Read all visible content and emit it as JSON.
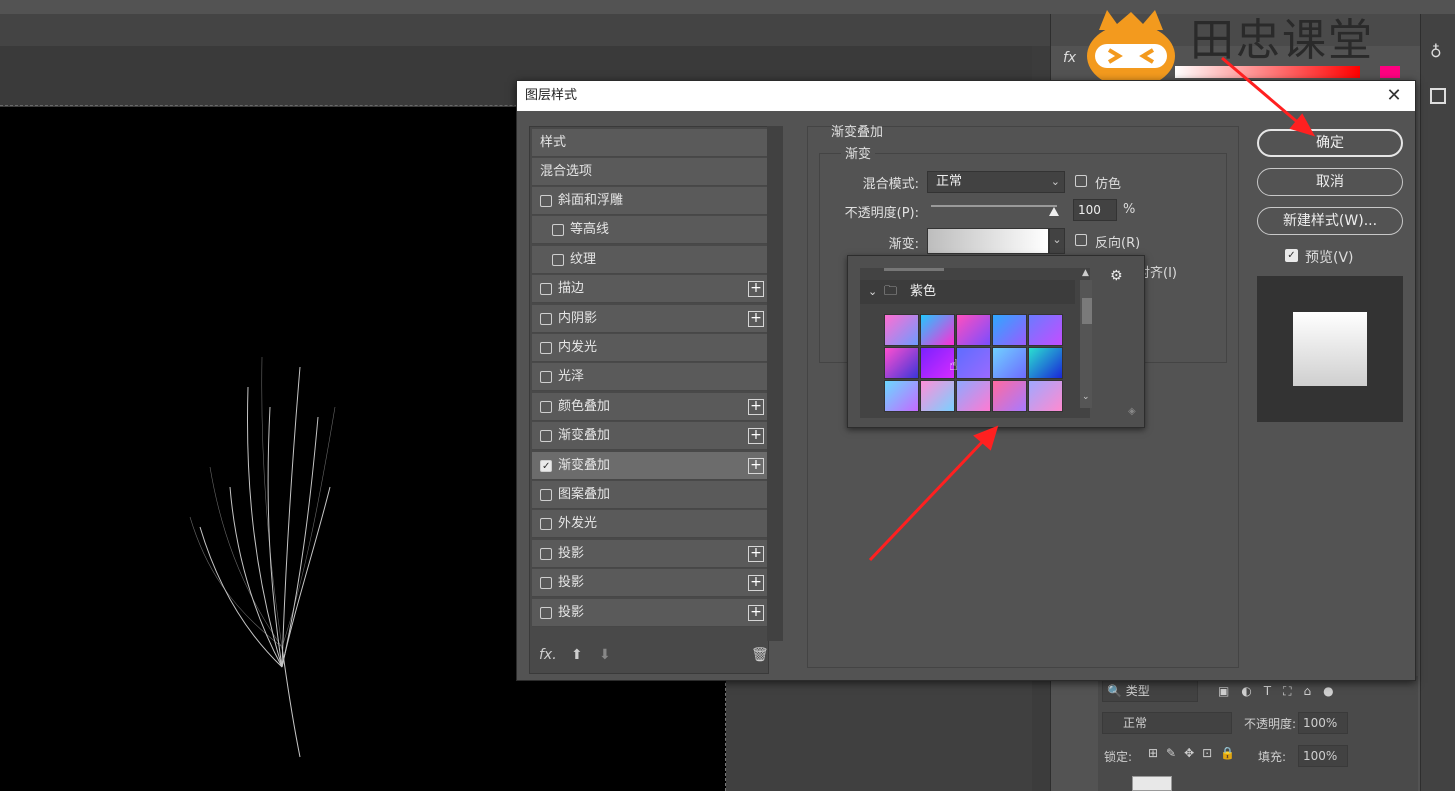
{
  "dialog": {
    "title": "图层样式",
    "close_label": "✕",
    "styles_header": "样式",
    "blend_options": "混合选项",
    "items": [
      {
        "label": "斜面和浮雕",
        "checked": false,
        "plus": false
      },
      {
        "label": "等高线",
        "checked": false,
        "plus": false
      },
      {
        "label": "纹理",
        "checked": false,
        "plus": false
      },
      {
        "label": "描边",
        "checked": false,
        "plus": true
      },
      {
        "label": "内阴影",
        "checked": false,
        "plus": true
      },
      {
        "label": "内发光",
        "checked": false,
        "plus": false
      },
      {
        "label": "光泽",
        "checked": false,
        "plus": false
      },
      {
        "label": "颜色叠加",
        "checked": false,
        "plus": true
      },
      {
        "label": "渐变叠加",
        "checked": false,
        "plus": true
      },
      {
        "label": "渐变叠加",
        "checked": true,
        "plus": true
      },
      {
        "label": "图案叠加",
        "checked": false,
        "plus": false
      },
      {
        "label": "外发光",
        "checked": false,
        "plus": false
      },
      {
        "label": "投影",
        "checked": false,
        "plus": true
      },
      {
        "label": "投影",
        "checked": false,
        "plus": true
      },
      {
        "label": "投影",
        "checked": false,
        "plus": true
      }
    ],
    "footer_fx": "fx.",
    "section_title": "渐变叠加",
    "sub_title": "渐变",
    "blend_mode_label": "混合模式:",
    "blend_mode_value": "正常",
    "dither_label": "仿色",
    "opacity_label": "不透明度(P):",
    "opacity_value": "100",
    "opacity_unit": "%",
    "opacity_level": 1.0,
    "gradient_label": "渐变:",
    "reverse_label": "反向(R)",
    "align_label_partial": "对齐(I)",
    "picker": {
      "folder_name": "紫色",
      "swatches": [
        [
          "#ff6ed2",
          "#6e9bff"
        ],
        [
          "#22c8ff",
          "#ff2dd6"
        ],
        [
          "#ff4fbf",
          "#7a4dff"
        ],
        [
          "#2ea8ff",
          "#9a5bff"
        ],
        [
          "#6b7bff",
          "#c44dff"
        ],
        [
          "#ff4fd0",
          "#3b35d8"
        ],
        [
          "#7a22ff",
          "#d62bff"
        ],
        [
          "#5f6dff",
          "#9a6aff"
        ],
        [
          "#6fd1ff",
          "#6e6bff"
        ],
        [
          "#2ae0d0",
          "#1a26d8"
        ],
        [
          "#6bd8ff",
          "#c46aff"
        ],
        [
          "#ff8fd8",
          "#7ad0ff"
        ],
        [
          "#8fa8ff",
          "#ff7ad2"
        ],
        [
          "#ff6aa0",
          "#a77aff"
        ],
        [
          "#a0a8ff",
          "#ff8ad0"
        ]
      ]
    },
    "buttons": {
      "ok": "确定",
      "cancel": "取消",
      "new_style": "新建样式(W)..."
    },
    "preview_label": "预览(V)",
    "preview_checked": true
  },
  "right_panel": {
    "fx_label": "fx",
    "layers_filter": "类型",
    "layers_blend": "正常",
    "layers_opacity_label": "不透明度:",
    "layers_opacity_value": "100%",
    "lock_label": "锁定:",
    "fill_label": "填充:",
    "fill_value": "100%"
  },
  "watermark": {
    "text": "田忠课堂"
  },
  "colors": {
    "annotation_arrow": "#ff2020",
    "dialog_bg": "#535353"
  }
}
